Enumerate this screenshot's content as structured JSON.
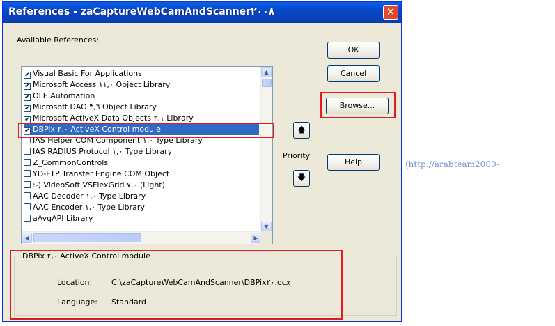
{
  "dialog": {
    "title": "References - zaCaptureWebCamAndScanner٢٠٠٨",
    "close_glyph": "✕",
    "available_label": "Available References:",
    "buttons": {
      "ok": "OK",
      "cancel": "Cancel",
      "browse": "Browse...",
      "help": "Help"
    },
    "priority_label": "Priority",
    "up_glyph": "🡅",
    "down_glyph": "🡇",
    "references": [
      {
        "label": "Visual Basic For Applications",
        "checked": true
      },
      {
        "label": "Microsoft Access ١١,٠ Object Library",
        "checked": true
      },
      {
        "label": "OLE Automation",
        "checked": true
      },
      {
        "label": "Microsoft DAO ٣,٦ Object Library",
        "checked": true
      },
      {
        "label": "Microsoft ActiveX Data Objects ٢,١ Library",
        "checked": true
      },
      {
        "label": "DBPix ٢,٠ ActiveX Control module",
        "checked": true,
        "selected": true
      },
      {
        "label": "IAS Helper COM Component ١,٠ Type Library",
        "checked": false
      },
      {
        "label": "IAS RADIUS Protocol ١,٠ Type Library",
        "checked": false
      },
      {
        "label": "Z_CommonControls",
        "checked": false
      },
      {
        "label": "YD-FTP Transfer Engine COM Object",
        "checked": false
      },
      {
        "label": ":-) VideoSoft VSFlexGrid ٧,٠ (Light)",
        "checked": false
      },
      {
        "label": "AAC Decoder ١,٠ Type Library",
        "checked": false
      },
      {
        "label": "AAC Encoder ١,٠ Type Library",
        "checked": false
      },
      {
        "label": "aAvgAPI Library",
        "checked": false
      }
    ],
    "details": {
      "title": "DBPix ٢,٠ ActiveX Control module",
      "location_label": "Location:",
      "location_value": "C:\\zaCaptureWebCamAndScanner\\DBPix٢٠.ocx",
      "language_label": "Language:",
      "language_value": "Standard"
    }
  },
  "side_link_text": "(http://arabteam2000-",
  "colors": {
    "title_bar": "#0A5FE8",
    "selection": "#316AC5",
    "highlight_box": "#E31B23",
    "dialog_bg": "#ECE9D8",
    "link_text": "#6F95D0"
  },
  "icons": [
    "close-icon",
    "scroll-up-icon",
    "scroll-down-icon",
    "scroll-left-icon",
    "scroll-right-icon",
    "priority-up-icon",
    "priority-down-icon"
  ]
}
